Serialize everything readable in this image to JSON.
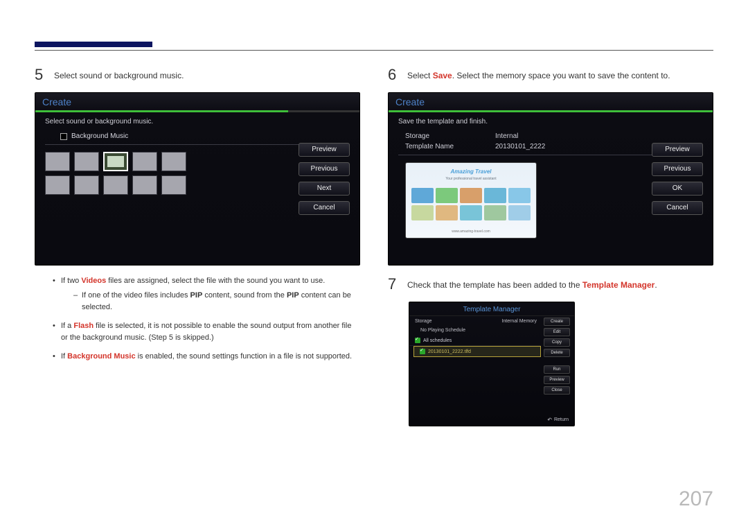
{
  "page_number": "207",
  "left": {
    "step5": {
      "num": "5",
      "text": "Select sound or background music."
    },
    "panelA": {
      "title": "Create",
      "progress_pct": 78,
      "instruction": "Select sound or background music.",
      "checkbox_label": "Background Music",
      "buttons": [
        "Preview",
        "Previous",
        "Next",
        "Cancel"
      ],
      "thumbs_total": 10,
      "thumb_selected_index": 2
    },
    "bullets": {
      "b1_pre": "If two ",
      "b1_red": "Videos",
      "b1_post": " files are assigned, select the file with the sound you want to use.",
      "b1s_pre": "If one of the video files includes ",
      "b1s_b1": "PIP",
      "b1s_mid": " content, sound from the ",
      "b1s_b2": "PIP",
      "b1s_post": " content can be selected.",
      "b2_pre": "If a ",
      "b2_red": "Flash",
      "b2_post": " file is selected, it is not possible to enable the sound output from another file or the background music. (Step 5 is skipped.)",
      "b3_pre": "If ",
      "b3_red": "Background Music",
      "b3_post": " is enabled, the sound settings function in a file is not supported."
    }
  },
  "right": {
    "step6": {
      "num": "6",
      "pre": "Select ",
      "red": "Save",
      "post": ". Select the memory space you want to save the content to."
    },
    "panelB": {
      "title": "Create",
      "progress_pct": 100,
      "instruction": "Save the template and finish.",
      "rows": {
        "storage_label": "Storage",
        "storage_value": "Internal",
        "tname_label": "Template Name",
        "tname_value": "20130101_2222"
      },
      "preview": {
        "title": "Amazing Travel",
        "subtitle": "Your professional travel assistant",
        "footer": "www.amazing-travel.com"
      },
      "buttons": [
        "Preview",
        "Previous",
        "OK",
        "Cancel"
      ]
    },
    "step7": {
      "num": "7",
      "pre": "Check that the template has been added to the ",
      "red": "Template Manager",
      "post": "."
    },
    "tm": {
      "title": "Template Manager",
      "storage_label": "Storage",
      "storage_value": "Internal Memory",
      "no_schedule": "No Playing Schedule",
      "allrow": "All schedules",
      "selrow": "20130101_2222.tlfd",
      "buttons": [
        "Create",
        "Edit",
        "Copy",
        "Delete",
        "Run",
        "Preview",
        "Close"
      ],
      "return": "Return"
    }
  }
}
